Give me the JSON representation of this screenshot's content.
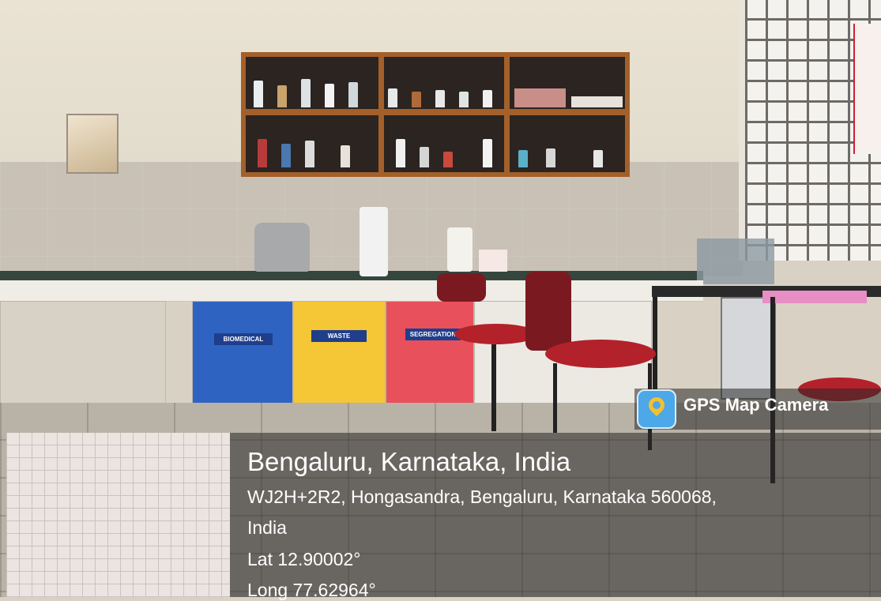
{
  "photo": {
    "bin_labels": [
      "BIOMEDICAL",
      "WASTE",
      "SEGREGATION"
    ]
  },
  "gps_badge": {
    "icon": "map-pin-camera-icon",
    "text": "GPS Map Camera"
  },
  "location": {
    "city_line": "Bengaluru, Karnataka, India",
    "address_line1": "WJ2H+2R2, Hongasandra, Bengaluru, Karnataka 560068,",
    "address_line2": "India",
    "lat": "Lat 12.90002°",
    "long": "Long 77.62964°"
  },
  "colors": {
    "bin_blue": "#2f63c2",
    "bin_yellow": "#f5c636",
    "bin_red": "#e8505b",
    "shelf_wood": "#a3602a",
    "overlay": "rgba(40,40,40,0.55)"
  }
}
